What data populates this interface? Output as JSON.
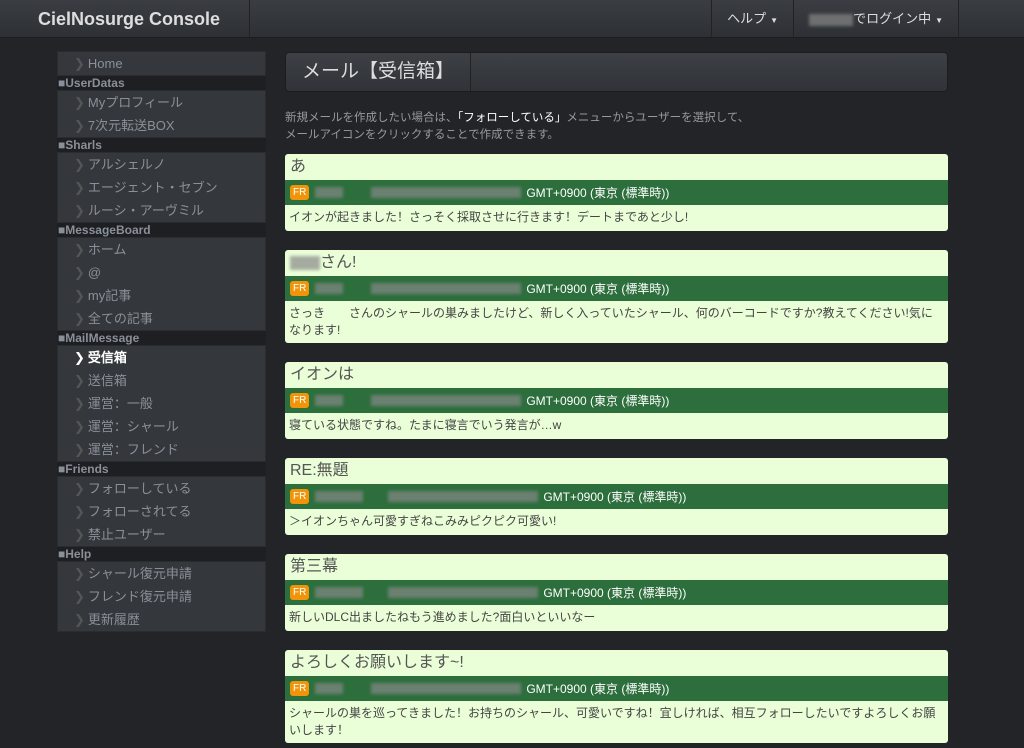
{
  "nav": {
    "brand": "CielNosurge Console",
    "help": "ヘルプ",
    "login": "でログイン中"
  },
  "sidebar": [
    {
      "section": "",
      "items": [
        {
          "label": "Home"
        }
      ]
    },
    {
      "section": "■UserDatas",
      "items": [
        {
          "label": "Myプロフィール"
        },
        {
          "label": "7次元転送BOX"
        }
      ]
    },
    {
      "section": "■Sharls",
      "items": [
        {
          "label": "アルシェルノ"
        },
        {
          "label": "エージェント・セブン"
        },
        {
          "label": "ルーシ・アーヴミル"
        }
      ]
    },
    {
      "section": "■MessageBoard",
      "items": [
        {
          "label": "ホーム"
        },
        {
          "label": "@"
        },
        {
          "label": "my記事"
        },
        {
          "label": "全ての記事"
        }
      ]
    },
    {
      "section": "■MailMessage",
      "items": [
        {
          "label": "受信箱",
          "active": true
        },
        {
          "label": "送信箱"
        },
        {
          "label": "運営：一般"
        },
        {
          "label": "運営：シャール"
        },
        {
          "label": "運営：フレンド"
        }
      ]
    },
    {
      "section": "■Friends",
      "items": [
        {
          "label": "フォローしている"
        },
        {
          "label": "フォローされてる"
        },
        {
          "label": "禁止ユーザー"
        }
      ]
    },
    {
      "section": "■Help",
      "items": [
        {
          "label": "シャール復元申請"
        },
        {
          "label": "フレンド復元申請"
        },
        {
          "label": "更新履歴"
        }
      ]
    }
  ],
  "page": {
    "title": "メール【受信箱】",
    "intro_pre": "新規メールを作成したい場合は、",
    "intro_link": "「フォローしている」",
    "intro_post": "メニューからユーザーを選択して、",
    "intro_line2": "メールアイコンをクリックすることで作成できます。"
  },
  "badge": "FR",
  "mails": [
    {
      "title": "あ",
      "date": "GMT+0900 (東京 (標準時))",
      "body": "イオンが起きました！さっそく採取させに行きます！デートまであと少し!"
    },
    {
      "title": "さん!",
      "blur_title": true,
      "date": "GMT+0900 (東京 (標準時))",
      "body": "さっき　　さんのシャールの巣みましたけど、新しく入っていたシャール、何のバーコードですか?教えてください!気になります!"
    },
    {
      "title": "イオンは",
      "date": "GMT+0900 (東京 (標準時))",
      "body": "寝ている状態ですね。たまに寝言でいう発言が…w"
    },
    {
      "title": "RE:無題",
      "date": "GMT+0900 (東京 (標準時))",
      "body": "＞イオンちゃん可愛すぎねこみみピクピク可愛い!",
      "long": true
    },
    {
      "title": "第三幕",
      "date": "GMT+0900 (東京 (標準時))",
      "body": "新しいDLC出ましたねもう進めました?面白いといいなー",
      "long": true
    },
    {
      "title": "よろしくお願いします~!",
      "date": "GMT+0900 (東京 (標準時))",
      "body": "シャールの巣を巡ってきました！お持ちのシャール、可愛いですね！宜しければ、相互フォローしたいですよろしくお願いします！"
    }
  ]
}
